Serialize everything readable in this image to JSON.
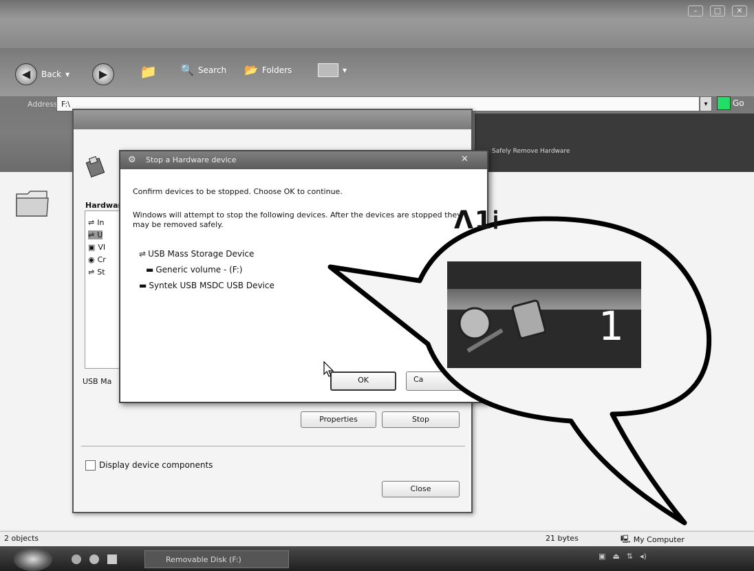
{
  "toolbar": {
    "back_label": "Back",
    "search_label": "Search",
    "folders_label": "Folders"
  },
  "address": {
    "label": "Address",
    "value": "F:\\",
    "go_label": "Go"
  },
  "right_panel": {
    "text": "Safely Remove Hardware"
  },
  "safely_remove_window": {
    "hardware_label": "Hardware devices:",
    "devices": [
      "In",
      "U",
      "VI",
      "Cr",
      "St"
    ],
    "selected_device_label": "USB Ma",
    "properties_label": "Properties",
    "stop_label": "Stop",
    "display_components_label": "Display device components",
    "close_label": "Close"
  },
  "stop_dialog": {
    "title": "Stop a Hardware device",
    "confirm_text": "Confirm devices to be stopped. Choose OK to continue.",
    "explain_text": "Windows will attempt to stop the following devices. After the devices are stopped they may be removed safely.",
    "devices": [
      "USB Mass Storage Device",
      "Generic volume - (F:)",
      "Syntek USB MSDC USB Device"
    ],
    "ok_label": "OK",
    "cancel_label": "Ca"
  },
  "callout": {
    "text": "ᐱ1Ꭵ",
    "magnified_number": "1"
  },
  "status_bar": {
    "object_count": "2 objects",
    "size": "21 bytes",
    "location": "My Computer"
  },
  "taskbar": {
    "task_label": "Removable Disk (F:)"
  }
}
